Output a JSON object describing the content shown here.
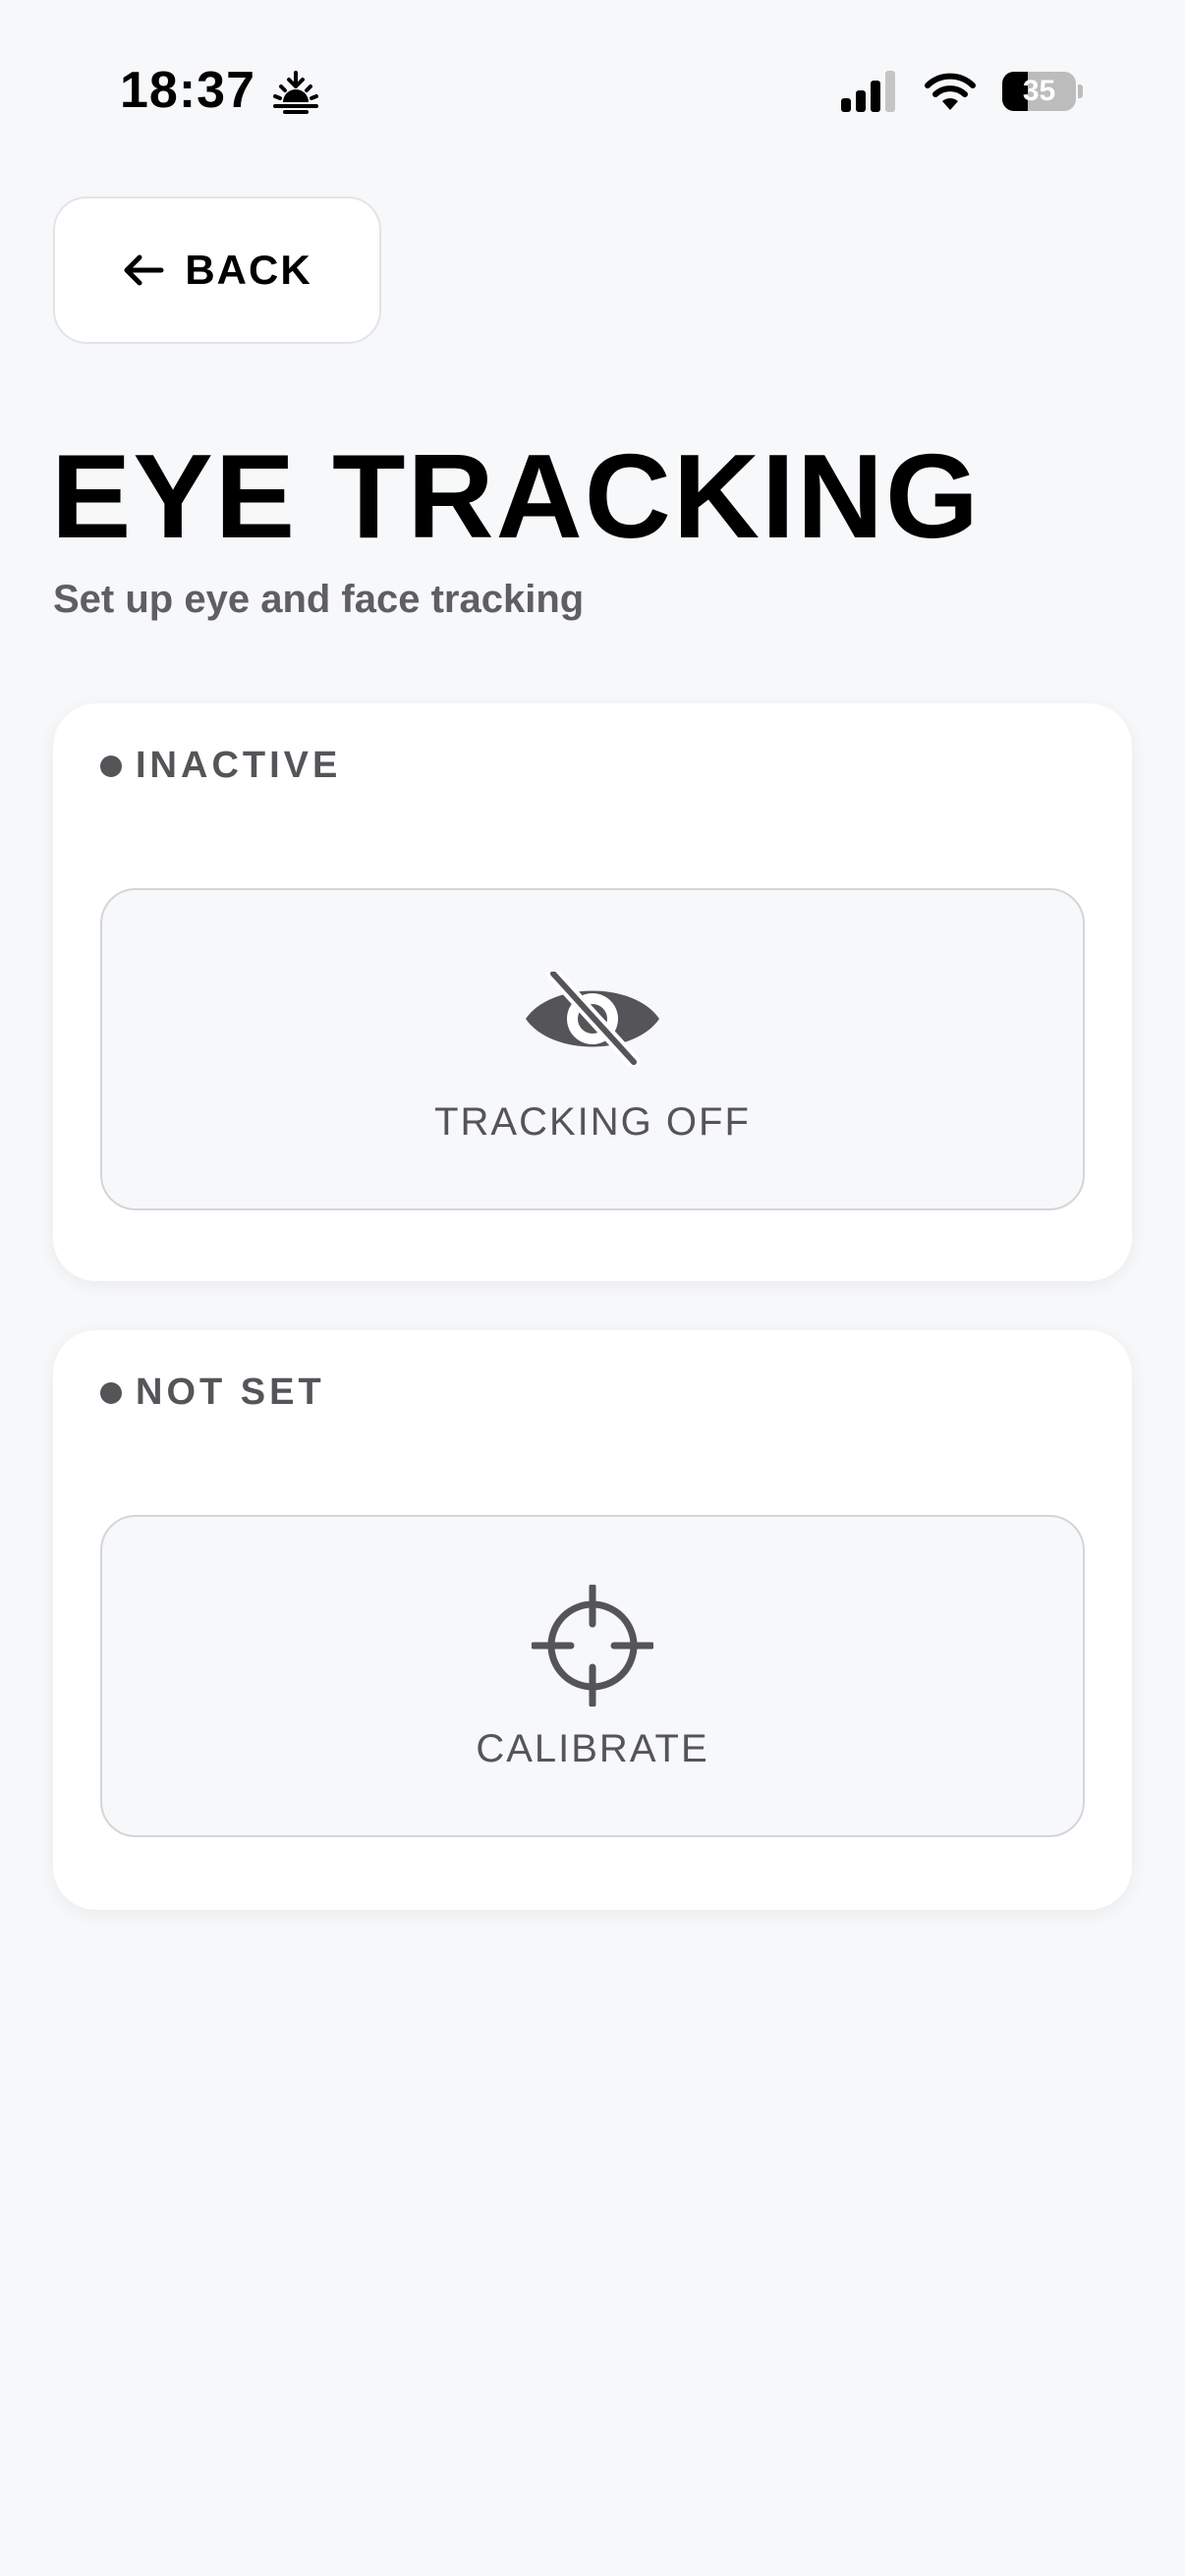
{
  "status_bar": {
    "time": "18:37",
    "time_icon": "sunrise-icon",
    "battery_level": "35",
    "icons": [
      "cellular-signal-icon",
      "wifi-icon",
      "battery-icon"
    ]
  },
  "header": {
    "back_label": "BACK",
    "back_icon": "arrow-left-icon",
    "title": "EYE TRACKING",
    "subtitle": "Set up eye and face tracking"
  },
  "cards": [
    {
      "status": "INACTIVE",
      "action_label": "TRACKING OFF",
      "action_icon": "eye-slash-icon"
    },
    {
      "status": "NOT SET",
      "action_label": "CALIBRATE",
      "action_icon": "crosshair-icon"
    }
  ],
  "colors": {
    "background": "#f7f8fa",
    "card": "#ffffff",
    "muted_text": "#555559",
    "border": "#d4d5d9"
  }
}
